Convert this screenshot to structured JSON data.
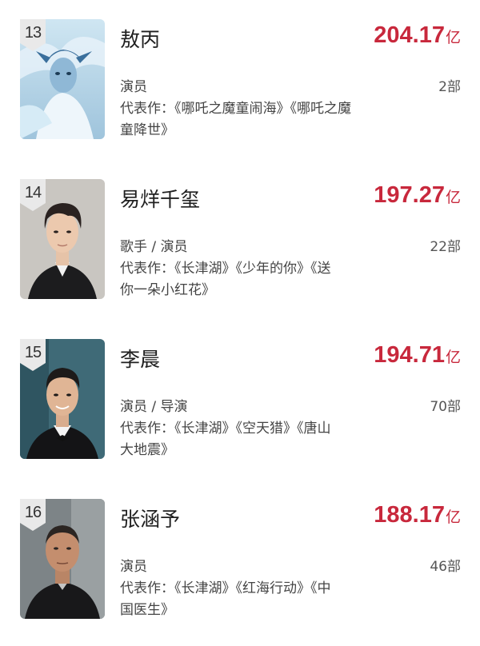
{
  "ranking": [
    {
      "rank": "13",
      "name": "敖丙",
      "box_office": "204.17",
      "unit": "亿",
      "role": "演员",
      "film_count": "2部",
      "works_line1": "代表作：《哪吒之魔童闹海》《哪吒之魔",
      "works_line2": "童降世》"
    },
    {
      "rank": "14",
      "name": "易烊千玺",
      "box_office": "197.27",
      "unit": "亿",
      "role": "歌手 / 演员",
      "film_count": "22部",
      "works_line1": "代表作：《长津湖》《少年的你》《送",
      "works_line2": "你一朵小红花》"
    },
    {
      "rank": "15",
      "name": "李晨",
      "box_office": "194.71",
      "unit": "亿",
      "role": "演员 / 导演",
      "film_count": "70部",
      "works_line1": "代表作：《长津湖》《空天猎》《唐山",
      "works_line2": "大地震》"
    },
    {
      "rank": "16",
      "name": "张涵予",
      "box_office": "188.17",
      "unit": "亿",
      "role": "演员",
      "film_count": "46部",
      "works_line1": "代表作：《长津湖》《红海行动》《中",
      "works_line2": "国医生》"
    }
  ],
  "colors": {
    "box_office": "#c8283c",
    "badge": "#e9e9e9"
  },
  "icons": {
    "rank_badge": "shield-badge"
  }
}
